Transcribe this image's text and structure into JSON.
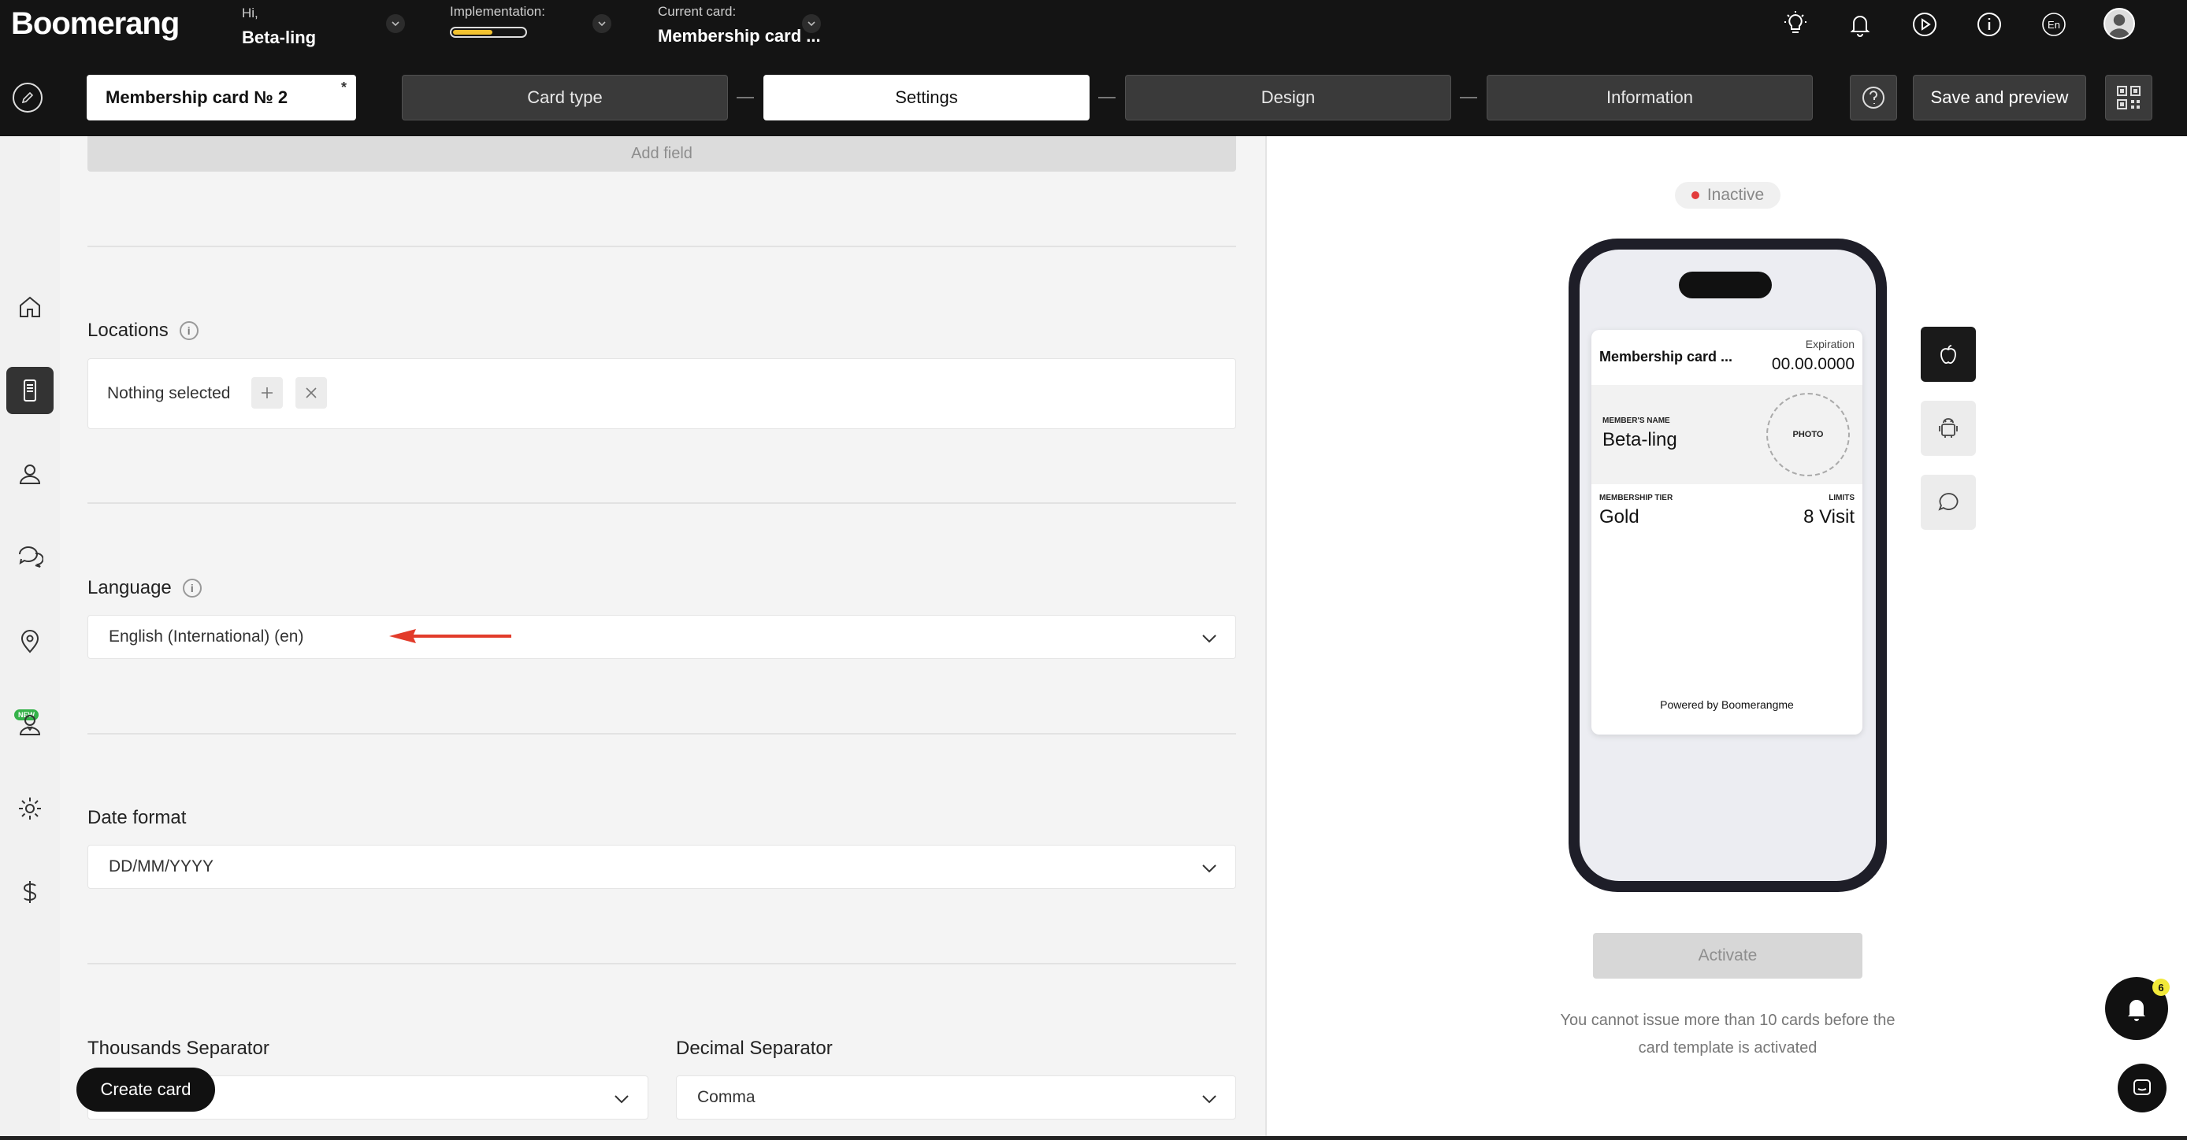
{
  "header": {
    "logo": "Boomerang",
    "greeting": "Hi,",
    "user_name": "Beta-ling",
    "implementation_label": "Implementation:",
    "implementation_progress": 0.55,
    "current_card_label": "Current card:",
    "current_card_name": "Membership card ...",
    "language_code": "En",
    "icons": [
      "lightbulb-icon",
      "bell-icon",
      "play-icon",
      "info-icon",
      "language-icon",
      "avatar"
    ]
  },
  "nav": {
    "card_title": "Membership card № 2",
    "card_title_marker": "*",
    "steps": [
      {
        "label": "Card type"
      },
      {
        "label": "Settings"
      },
      {
        "label": "Design"
      },
      {
        "label": "Information"
      }
    ],
    "active_step": "Settings",
    "save_preview_label": "Save and preview"
  },
  "sidebar": {
    "items": [
      "home-icon",
      "cards-icon",
      "clients-icon",
      "messages-icon",
      "locations-icon",
      "managers-icon",
      "settings-icon",
      "billing-icon"
    ],
    "new_badge": "NEW"
  },
  "form": {
    "add_field_label": "Add field",
    "locations": {
      "label": "Locations",
      "value": "Nothing selected"
    },
    "language": {
      "label": "Language",
      "value": "English (International) (en)"
    },
    "date_format": {
      "label": "Date format",
      "value": "DD/MM/YYYY"
    },
    "thousands_separator": {
      "label": "Thousands Separator",
      "value": ""
    },
    "decimal_separator": {
      "label": "Decimal Separator",
      "value": "Comma"
    },
    "create_card_label": "Create card"
  },
  "preview": {
    "status": "Inactive",
    "status_color": "#e23b3b",
    "card": {
      "title": "Membership card ...",
      "expiration_label": "Expiration",
      "expiration_value": "00.00.0000",
      "member_name_label": "MEMBER'S NAME",
      "member_name": "Beta-ling",
      "photo_label": "PHOTO",
      "tier_label": "MEMBERSHIP TIER",
      "tier_value": "Gold",
      "limits_label": "LIMITS",
      "limits_value": "8 Visit",
      "powered_by": "Powered by Boomerangme"
    },
    "platforms": [
      "apple-icon",
      "android-icon",
      "chat-icon"
    ],
    "activate_label": "Activate",
    "limit_note": "You cannot issue more than 10 cards before the card template is activated",
    "notification_count": "6"
  },
  "colors": {
    "topbar_bg": "#141414",
    "accent_yellow": "#f2c230",
    "arrow_red": "#e23b2a"
  }
}
